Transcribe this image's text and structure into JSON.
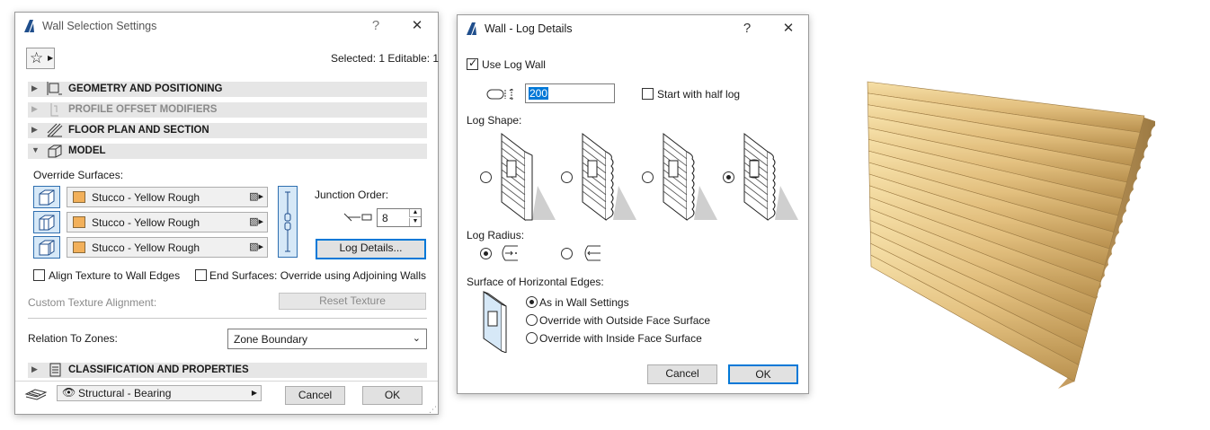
{
  "wall_dialog": {
    "title": "Wall Selection Settings",
    "help": "?",
    "close": "✕",
    "selected_info": "Selected: 1 Editable: 1",
    "sections": {
      "geometry": "GEOMETRY AND POSITIONING",
      "profile": "PROFILE OFFSET MODIFIERS",
      "floorplan": "FLOOR PLAN AND SECTION",
      "model": "MODEL",
      "classification": "CLASSIFICATION AND PROPERTIES"
    },
    "override_surfaces_label": "Override Surfaces:",
    "surfaces": [
      "Stucco - Yellow Rough",
      "Stucco - Yellow Rough",
      "Stucco - Yellow Rough"
    ],
    "junction_order_label": "Junction Order:",
    "junction_order_value": "8",
    "log_details_button": "Log Details...",
    "align_texture_label": "Align Texture to Wall Edges",
    "end_surfaces_label": "End Surfaces: Override using Adjoining Walls",
    "custom_texture_label": "Custom Texture Alignment:",
    "reset_texture_button": "Reset Texture",
    "relation_zones_label": "Relation To Zones:",
    "relation_zones_value": "Zone Boundary",
    "structural_value": "Structural - Bearing",
    "cancel": "Cancel",
    "ok": "OK"
  },
  "log_dialog": {
    "title": "Wall - Log Details",
    "help": "?",
    "close": "✕",
    "use_log_wall_label": "Use Log Wall",
    "use_log_wall_checked": true,
    "log_height_value": "200",
    "start_half_log_label": "Start with half log",
    "start_half_log_checked": false,
    "log_shape_label": "Log Shape:",
    "log_shape_selected_index": 3,
    "log_radius_label": "Log Radius:",
    "log_radius_selected_index": 0,
    "surface_edges_label": "Surface of Horizontal Edges:",
    "surface_options": [
      "As in Wall Settings",
      "Override with Outside Face Surface",
      "Override with Inside Face Surface"
    ],
    "surface_selected_index": 0,
    "cancel": "Cancel",
    "ok": "OK"
  },
  "colors": {
    "accent": "#0078d7",
    "surface_swatch": "#f2b05a",
    "log_wood": "#e3c07f"
  }
}
